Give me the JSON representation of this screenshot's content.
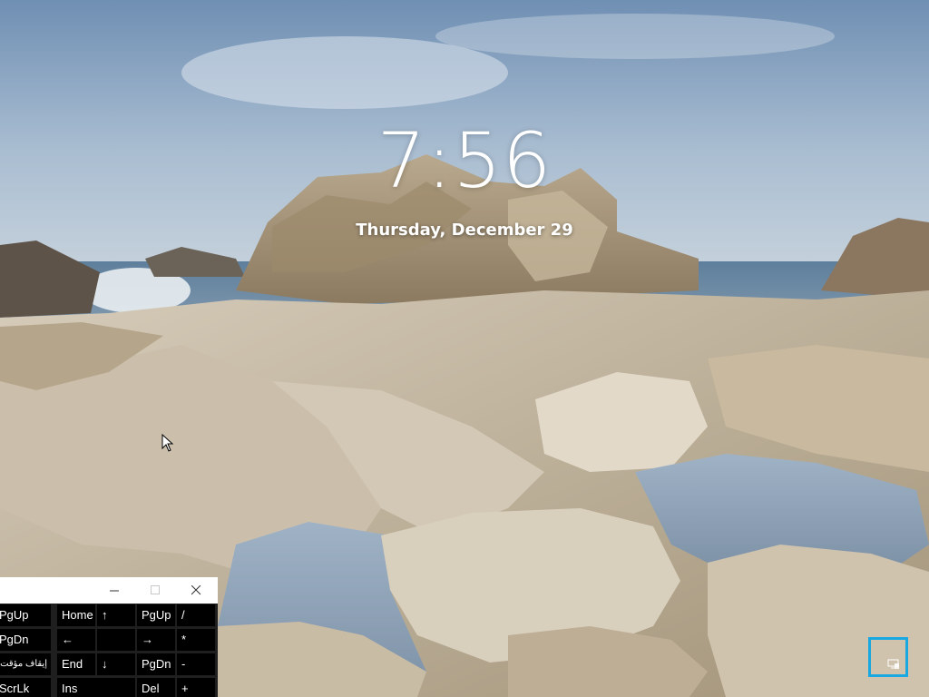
{
  "lock_screen": {
    "time": "7:56",
    "date": "Thursday, December 29"
  },
  "on_screen_keyboard": {
    "title_buttons": [
      "minimize",
      "maximize",
      "close"
    ],
    "rows": [
      [
        "PgUp",
        "Home",
        "↑",
        "PgUp",
        "/"
      ],
      [
        "PgDn",
        "←",
        "",
        "→",
        "*"
      ],
      [
        "إيقاف مؤقت",
        "End",
        "↓",
        "PgDn",
        "-"
      ],
      [
        "ScrLk",
        "Ins",
        "",
        "Del",
        "+"
      ]
    ]
  },
  "icons": {
    "cursor": "mouse-pointer-icon",
    "network": "network-icon"
  },
  "colors": {
    "osk_key": "#000000",
    "osk_background": "#1f1f1f",
    "focus_border": "#19a8e0",
    "text": "#ffffff"
  }
}
